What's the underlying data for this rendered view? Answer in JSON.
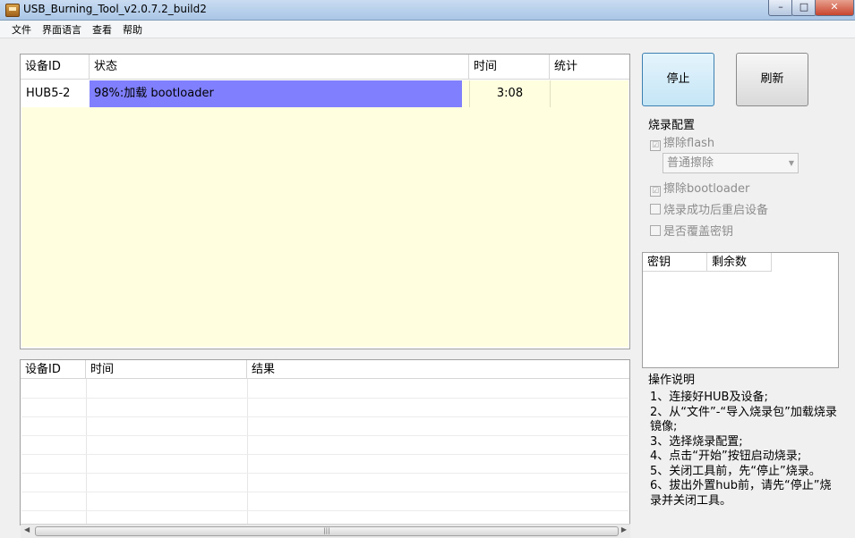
{
  "window": {
    "title": "USB_Burning_Tool_v2.0.7.2_build2",
    "min": "–",
    "max": "□",
    "close": "✕"
  },
  "menu": [
    "文件",
    "界面语言",
    "查看",
    "帮助"
  ],
  "device_table": {
    "headers": [
      "设备ID",
      "状态",
      "时间",
      "统计"
    ],
    "rows": [
      {
        "id": "HUB5-2",
        "status": "98%:加载 bootloader",
        "progress": 0.98,
        "time": "3:08",
        "stat": ""
      }
    ]
  },
  "log_table": {
    "headers": [
      "设备ID",
      "时间",
      "结果"
    ]
  },
  "buttons": {
    "stop": "停止",
    "refresh": "刷新"
  },
  "config": {
    "title": "烧录配置",
    "erase_flash": "擦除flash",
    "erase_mode": "普通擦除",
    "erase_bootloader": "擦除bootloader",
    "reboot_after": "烧录成功后重启设备",
    "overwrite_key": "是否覆盖密钥",
    "check_mark": "☑"
  },
  "key_table": {
    "headers": [
      "密钥",
      "剩余数"
    ]
  },
  "instructions": {
    "title": "操作说明",
    "lines": [
      "1、连接好HUB及设备;",
      "2、从“文件”-“导入烧录包”加载烧录镜像;",
      "3、选择烧录配置;",
      "4、点击“开始”按钮启动烧录;",
      "5、关闭工具前，先“停止”烧录。",
      "6、拔出外置hub前，请先“停止”烧录并关闭工具。"
    ]
  },
  "colors": {
    "progress": "#8080ff",
    "table_bg": "#ffffe0"
  }
}
